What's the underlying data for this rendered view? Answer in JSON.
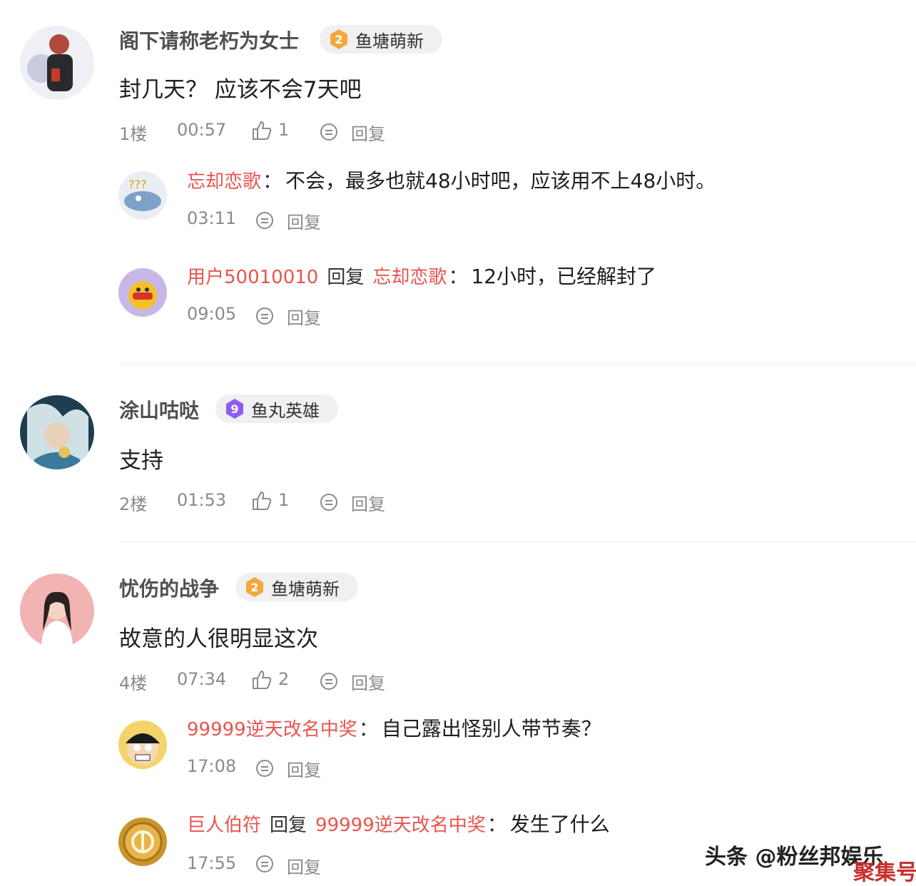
{
  "comments": [
    {
      "username": "阁下请称老朽为女士",
      "badge": {
        "level": "2",
        "label": "鱼塘萌新"
      },
      "text": "封几天？ 应该不会7天吧",
      "floor": "1楼",
      "time": "00:57",
      "likes": "1",
      "reply_label": "回复",
      "replies": [
        {
          "author": "忘却恋歌",
          "text": "不会，最多也就48小时吧，应该用不上48小时。",
          "time": "03:11",
          "reply_label": "回复"
        },
        {
          "author": "用户50010010",
          "verb": "回复",
          "target": "忘却恋歌",
          "text": "12小时，已经解封了",
          "time": "09:05",
          "reply_label": "回复"
        }
      ]
    },
    {
      "username": "涂山咕哒",
      "badge": {
        "level": "9",
        "label": "鱼丸英雄"
      },
      "text": "支持",
      "floor": "2楼",
      "time": "01:53",
      "likes": "1",
      "reply_label": "回复"
    },
    {
      "username": "忧伤的战争",
      "badge": {
        "level": "2",
        "label": "鱼塘萌新"
      },
      "text": "故意的人很明显这次",
      "floor": "4楼",
      "time": "07:34",
      "likes": "2",
      "reply_label": "回复",
      "replies": [
        {
          "author": "99999逆天改名中奖",
          "text": "自己露出怪别人带节奏？",
          "time": "17:08",
          "reply_label": "回复"
        },
        {
          "author": "巨人伯符",
          "verb": "回复",
          "target": "99999逆天改名中奖",
          "text": "发生了什么",
          "time": "17:55",
          "reply_label": "回复"
        }
      ]
    }
  ],
  "watermark": {
    "main": "头条 @粉丝邦娱乐",
    "corner": "聚集号"
  },
  "colors": {
    "reply_author": "#e9544f",
    "badge_gold": "#f2a93b",
    "badge_purple": "#8e5cf0",
    "meta": "#8a8a8a"
  }
}
